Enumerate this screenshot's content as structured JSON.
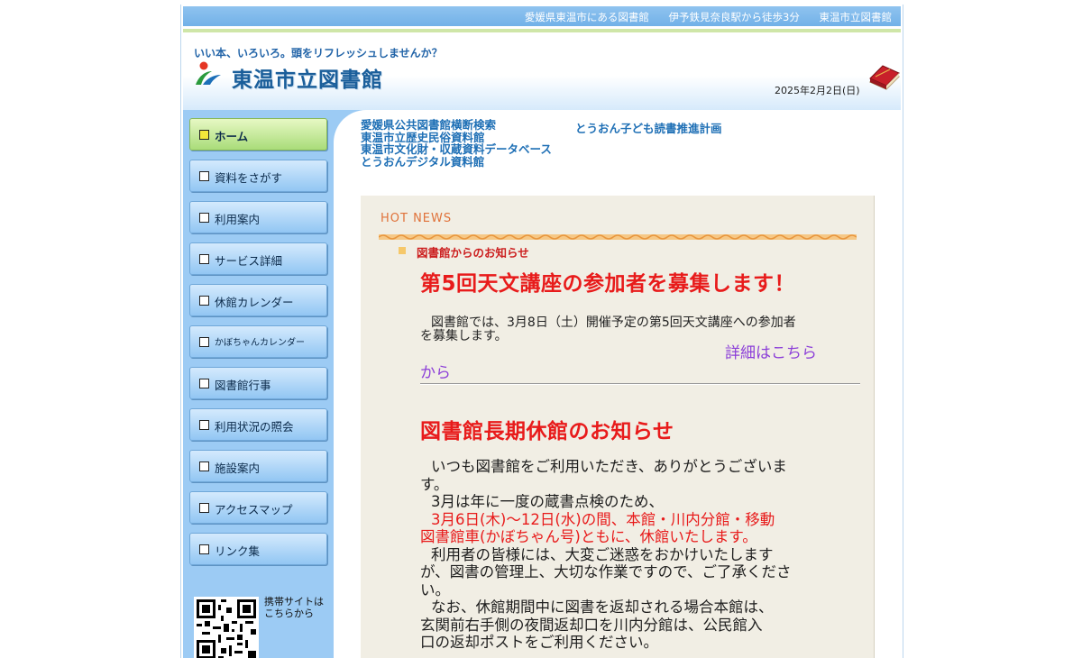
{
  "topbar": {
    "links": [
      "愛媛県東温市にある図書館",
      "伊予鉄見奈良駅から徒歩3分",
      "東温市立図書館"
    ]
  },
  "header": {
    "tagline": "いい本、いろいろ。頭をリフレッシュしませんか？",
    "title": "東温市立図書館",
    "date": "2025年2月2日(日)",
    "logo_icon": "library-logo-icon",
    "book_icon": "red-book-icon"
  },
  "sidebar": {
    "items": [
      {
        "label": "ホーム",
        "active": true
      },
      {
        "label": "資料をさがす"
      },
      {
        "label": "利用案内"
      },
      {
        "label": "サービス詳細"
      },
      {
        "label": "休館カレンダー"
      },
      {
        "label": "かぼちゃんカレンダー"
      },
      {
        "label": "図書館行事"
      },
      {
        "label": "利用状況の照会"
      },
      {
        "label": "施設案内"
      },
      {
        "label": "アクセスマップ"
      },
      {
        "label": "リンク集"
      }
    ],
    "mobile_text": "携帯サイトは\nこちらから"
  },
  "quick_links": {
    "left": [
      "愛媛県公共図書館横断検索",
      "東温市立歴史民俗資料館",
      "東温市文化財・収蔵資料データベース",
      "とうおんデジタル資料館"
    ],
    "right": "とうおん子ども読書推進計画"
  },
  "news": {
    "heading": "HOT NEWS",
    "section_title": "図書館からのお知らせ",
    "item1": {
      "title": "第5回天文講座の参加者を募集します！",
      "body_line1": "図書館では、3月8日（土）開催予定の第5回天文講座への参加者",
      "body_line2": "を募集します。",
      "more_link": "詳細はこちら",
      "more_link_tail": "から"
    },
    "item2": {
      "title": "図書館長期休館のお知らせ",
      "line1": "いつも図書館をご利用いただき、ありがとうございま",
      "line2": "す。",
      "line3": "3月は年に一度の蔵書点検のため、",
      "line4": "3月6日(木)～12日(水)の間、本館・川内分館・移動",
      "line5": "図書館車(かぼちゃん号)ともに、休館いたします。",
      "line6": "利用者の皆様には、大変ご迷惑をおかけいたします",
      "line7": "が、図書の管理上、大切な作業ですので、ご了承くださ",
      "line8": "い。",
      "line9": "なお、休館期間中に図書を返却される場合本館は、",
      "line10": "玄関前右手側の夜間返却口を川内分館は、公民館入",
      "line11": "口の返却ポストをご利用ください。"
    }
  }
}
